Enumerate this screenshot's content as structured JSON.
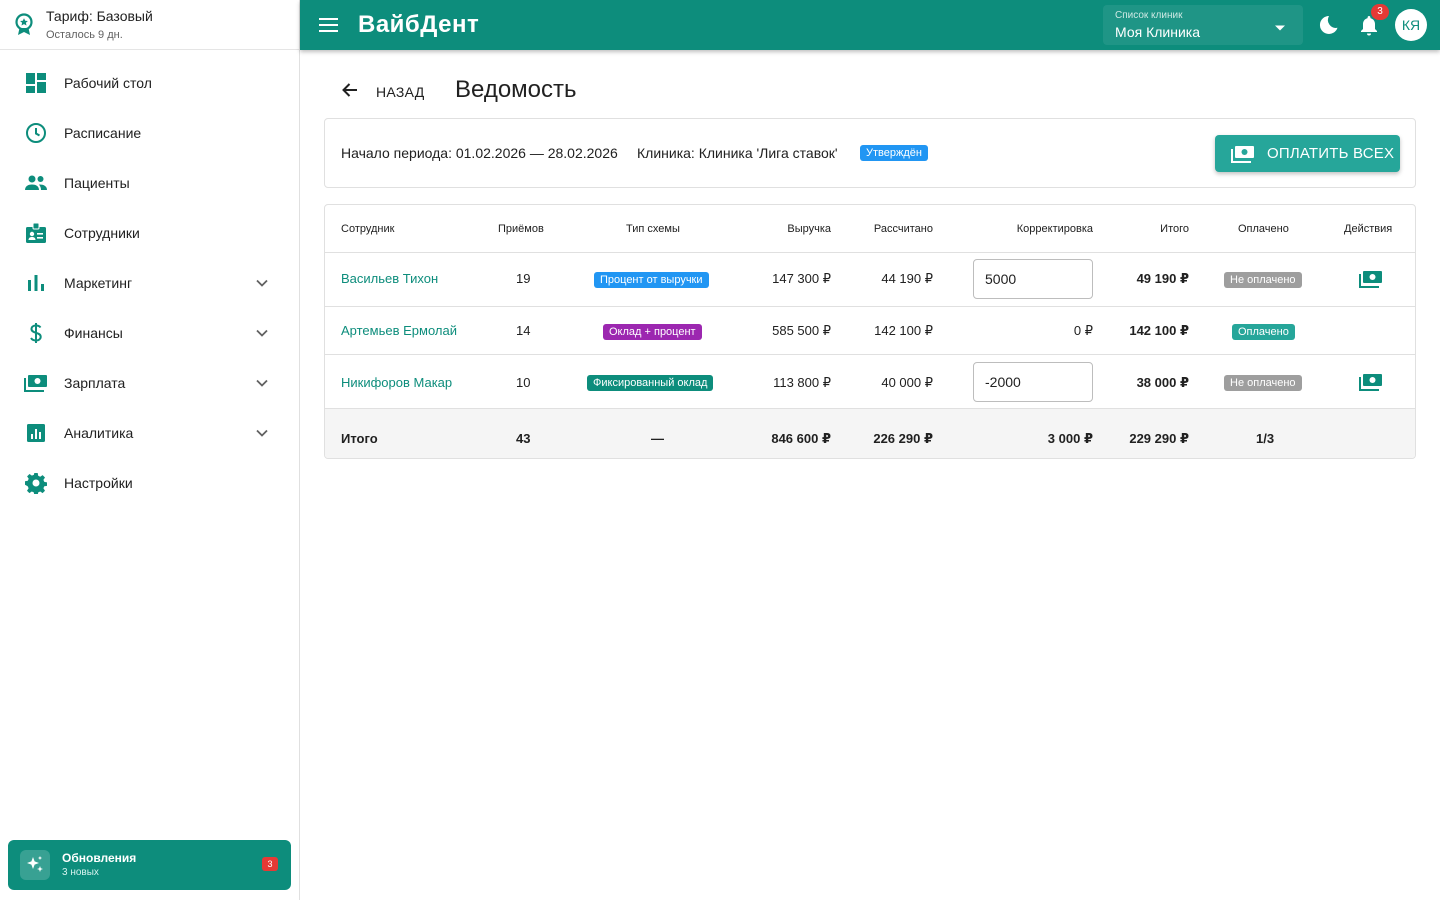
{
  "sidebar": {
    "tariff_title": "Тариф: Базовый",
    "tariff_sub": "Осталось 9 дн.",
    "items": [
      {
        "label": "Рабочий стол",
        "icon": "dashboard-icon",
        "expandable": false
      },
      {
        "label": "Расписание",
        "icon": "clock-icon",
        "expandable": false
      },
      {
        "label": "Пациенты",
        "icon": "people-icon",
        "expandable": false
      },
      {
        "label": "Сотрудники",
        "icon": "badge-icon",
        "expandable": false
      },
      {
        "label": "Маркетинг",
        "icon": "bar-chart-icon",
        "expandable": true
      },
      {
        "label": "Финансы",
        "icon": "dollar-icon",
        "expandable": true
      },
      {
        "label": "Зарплата",
        "icon": "money-icon",
        "expandable": true
      },
      {
        "label": "Аналитика",
        "icon": "analytics-icon",
        "expandable": true
      },
      {
        "label": "Настройки",
        "icon": "gear-icon",
        "expandable": false
      }
    ],
    "updates": {
      "title": "Обновления",
      "subtitle": "3 новых",
      "count": "3"
    }
  },
  "topbar": {
    "brand": "ВайбДент",
    "clinic_label": "Список клиник",
    "clinic_value": "Моя Клиника",
    "notifications": "3",
    "avatar": "КЯ"
  },
  "page": {
    "back_label": "НАЗАД",
    "title": "Ведомость",
    "period": "Начало периода: 01.02.2026 — 28.02.2026",
    "clinic": "Клиника: Клиника 'Лига ставок'",
    "status": "Утверждён",
    "pay_all": "ОПЛАТИТЬ ВСЕХ"
  },
  "table": {
    "headers": {
      "employee": "Сотрудник",
      "visits": "Приёмов",
      "scheme": "Тип схемы",
      "revenue": "Выручка",
      "calculated": "Рассчитано",
      "correction": "Корректировка",
      "total": "Итого",
      "paid": "Оплачено",
      "actions": "Действия"
    },
    "rows": [
      {
        "employee": "Васильев Тихон",
        "visits": "19",
        "scheme": "Процент от выручки",
        "revenue": "147 300 ₽",
        "calculated": "44 190 ₽",
        "correction": "5000",
        "total": "49 190 ₽",
        "paid": "Не оплачено"
      },
      {
        "employee": "Артемьев Ермолай",
        "visits": "14",
        "scheme": "Оклад + процент",
        "revenue": "585 500 ₽",
        "calculated": "142 100 ₽",
        "correction": "0 ₽",
        "total": "142 100 ₽",
        "paid": "Оплачено"
      },
      {
        "employee": "Никифоров Макар",
        "visits": "10",
        "scheme": "Фиксированный оклад",
        "revenue": "113 800 ₽",
        "calculated": "40 000 ₽",
        "correction": "-2000",
        "total": "38 000 ₽",
        "paid": "Не оплачено"
      }
    ],
    "totals": {
      "label": "Итого",
      "visits": "43",
      "scheme": "—",
      "revenue": "846 600 ₽",
      "calculated": "226 290 ₽",
      "correction": "3 000 ₽",
      "total": "229 290 ₽",
      "paid": "1/3"
    }
  },
  "colors": {
    "primary": "#0d8d7c",
    "button": "#26a69a",
    "scheme_percent": "#2196f3",
    "scheme_salary_percent": "#9c27b0",
    "scheme_fixed": "#0d8d7c",
    "unpaid": "#9e9e9e",
    "paid": "#26a69a",
    "status_approved": "#2196f3",
    "badge": "#e53935"
  }
}
